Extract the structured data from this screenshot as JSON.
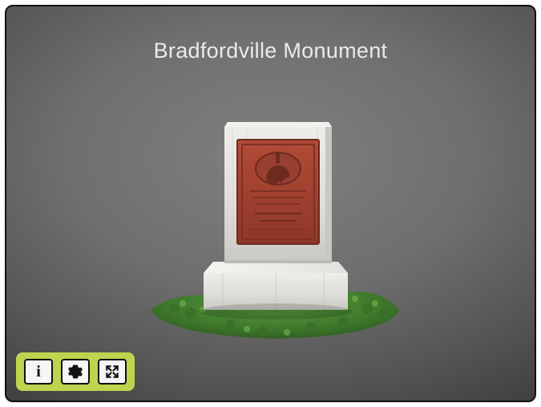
{
  "viewer": {
    "title": "Bradfordville Monument"
  },
  "toolbar": {
    "info": {
      "icon": "info-icon",
      "label": "i"
    },
    "settings": {
      "icon": "gear-icon"
    },
    "fullscreen": {
      "icon": "fullscreen-icon"
    }
  },
  "colors": {
    "toolbar_bg": "#c0d34e",
    "title_color": "#eceae7",
    "plaque": "#a43f2e",
    "marble_light": "#e9e8e6",
    "marble_shadow": "#c7c6c4",
    "grass_dark": "#2f5a24",
    "grass_light": "#4f8a34"
  }
}
